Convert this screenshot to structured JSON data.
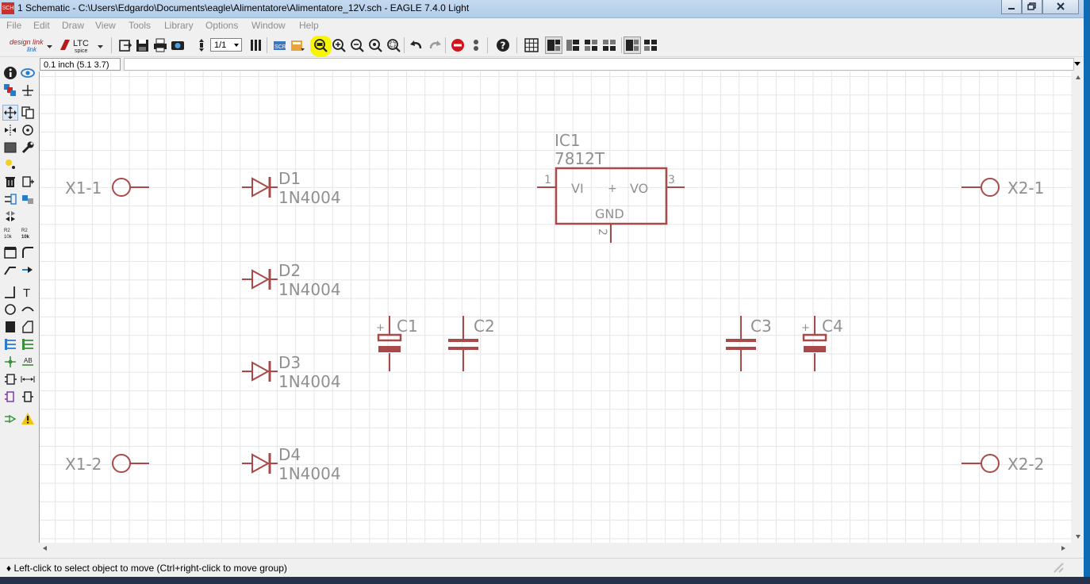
{
  "window": {
    "app_icon_text": "SCH",
    "title": "1 Schematic - C:\\Users\\Edgardo\\Documents\\eagle\\Alimentatore\\Alimentatore_12V.sch - EAGLE 7.4.0 Light"
  },
  "menu": [
    "File",
    "Edit",
    "Draw",
    "View",
    "Tools",
    "Library",
    "Options",
    "Window",
    "Help"
  ],
  "toolbar": {
    "design_link": "design link",
    "ltc_top": "LTC",
    "ltc_bottom": "spice",
    "sheet_value": "1/1",
    "highlighted_button": "zoom-to-fit",
    "highlight_color": "#f8f500"
  },
  "command": {
    "grid_coordinate": "0.1 inch (5.1 3.7)",
    "command_input": ""
  },
  "schematic": {
    "symbol_color": "#a94a4a",
    "label_color": "#909090",
    "parts": {
      "x1_1": "X1-1",
      "x1_2": "X1-2",
      "x2_1": "X2-1",
      "x2_2": "X2-2",
      "d1_name": "D1",
      "d1_value": "1N4004",
      "d2_name": "D2",
      "d2_value": "1N4004",
      "d3_name": "D3",
      "d3_value": "1N4004",
      "d4_name": "D4",
      "d4_value": "1N4004",
      "ic1_name": "IC1",
      "ic1_value": "7812T",
      "ic1_pin_vi": "VI",
      "ic1_pin_vo": "VO",
      "ic1_pin_gnd": "GND",
      "ic1_pin1": "1",
      "ic1_pin2": "2",
      "ic1_pin3": "3",
      "c1_name": "C1",
      "c2_name": "C2",
      "c3_name": "C3",
      "c4_name": "C4",
      "plus": "+"
    }
  },
  "status": {
    "text": "♦ Left-click to select object to move (Ctrl+right-click to move group)"
  }
}
